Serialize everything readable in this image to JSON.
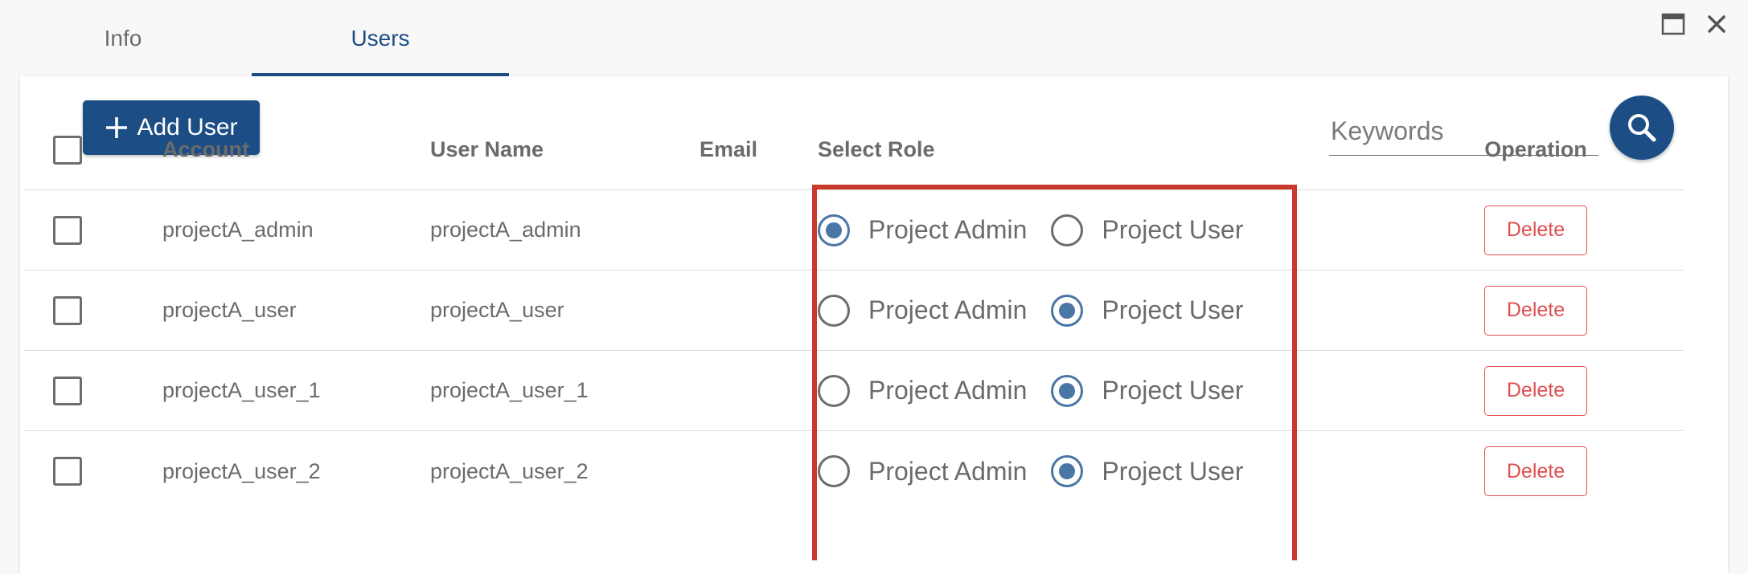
{
  "tabs": {
    "info": "Info",
    "users": "Users"
  },
  "window_icons": [
    "maximize-icon",
    "close-icon"
  ],
  "toolbar": {
    "add_user_label": "Add User",
    "search_placeholder": "Keywords"
  },
  "table": {
    "headers": {
      "account": "Account",
      "user_name": "User Name",
      "email": "Email",
      "select_role": "Select Role",
      "operation": "Operation"
    },
    "rows": [
      {
        "account": "projectA_admin",
        "user_name": "projectA_admin",
        "email": "",
        "role_options": [
          "Project Admin",
          "Project User"
        ],
        "selected_role": "Project Admin",
        "delete_label": "Delete"
      },
      {
        "account": "projectA_user",
        "user_name": "projectA_user",
        "email": "",
        "role_options": [
          "Project Admin",
          "Project User"
        ],
        "selected_role": "Project User",
        "delete_label": "Delete"
      },
      {
        "account": "projectA_user_1",
        "user_name": "projectA_user_1",
        "email": "",
        "role_options": [
          "Project Admin",
          "Project User"
        ],
        "selected_role": "Project User",
        "delete_label": "Delete"
      },
      {
        "account": "projectA_user_2",
        "user_name": "projectA_user_2",
        "email": "",
        "role_options": [
          "Project Admin",
          "Project User"
        ],
        "selected_role": "Project User",
        "delete_label": "Delete"
      }
    ]
  },
  "colors": {
    "primary": "#1c4e85",
    "radio_selected": "#4a76a5",
    "delete": "#e04f4f",
    "highlight": "#c9392c"
  }
}
